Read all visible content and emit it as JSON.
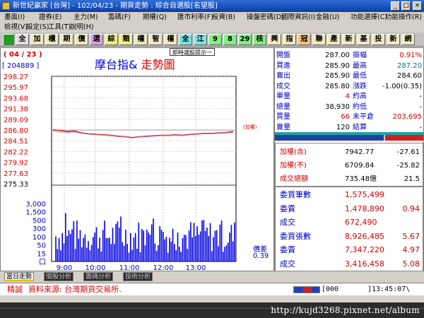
{
  "window": {
    "title": "新世紀贏家 [台灣] - 102/04/23 - 期貨走勢 : 綜合自選股[名望股]"
  },
  "menu": {
    "row1": [
      "畫面(I)",
      "證券(E)",
      "主力(M)",
      "籌碼(F)",
      "期權(Q)",
      "匯市利率(F)",
      "投資(B)",
      "操盤密碼(D)",
      "國際資訊(I)",
      "金融(U)",
      "功能選擇(C)",
      "功能操作(R)"
    ],
    "row2": [
      "檢視(V)",
      "設定(S)",
      "工具(T)",
      "說明(H)"
    ]
  },
  "toolbar": {
    "buttons": [
      "全",
      "加",
      "櫃",
      "期",
      "價",
      "選",
      "綜",
      "類",
      "權",
      "智",
      "權",
      "全",
      "江",
      "9",
      "8",
      "29",
      "核",
      "興",
      "指",
      "冠",
      "聯",
      "產",
      "新",
      "基",
      "投",
      "新",
      "網"
    ]
  },
  "chart": {
    "date": "( 04 / 23 )",
    "volume_readout": "[ 204889 ]",
    "title_black": "摩台指&",
    "title_red": "走勢圖",
    "popup_label": "即時選股提示一",
    "weighted_label": "(加權)",
    "spread_label": "價差",
    "spread_value": "0.39"
  },
  "chart_data": {
    "type": "line",
    "price_axis": [
      "298.27",
      "295.97",
      "293.68",
      "291.38",
      "289.09",
      "286.80",
      "284.51",
      "282.22",
      "279.92",
      "277.63",
      "275.33"
    ],
    "reference_price": "286.80",
    "volume_axis": [
      "3,000",
      "1,500",
      "500",
      "300",
      "100",
      "50",
      "15",
      "口"
    ],
    "time_labels": [
      "9:00",
      "10:00",
      "11:00",
      "12:00",
      "13:00"
    ],
    "ylim": [
      275.33,
      298.27
    ],
    "series": [
      {
        "values": [
          286.9,
          286.7,
          286.5,
          286.6,
          286.2,
          286.0,
          285.9,
          285.8,
          285.7,
          285.5,
          285.4,
          285.2,
          285.4,
          285.5,
          285.6,
          285.7,
          285.7,
          285.8,
          285.7,
          285.9,
          286.0,
          286.1,
          286.1,
          286.2,
          286.3,
          286.5
        ]
      },
      {
        "values": [
          286.6,
          286.4,
          286.3,
          286.4,
          286.1,
          285.9,
          285.8,
          285.7,
          285.6,
          285.4,
          285.3,
          285.1,
          285.3,
          285.4,
          285.5,
          285.6,
          285.6,
          285.7,
          285.6,
          285.8,
          285.9,
          286.0,
          286.0,
          286.1,
          286.2,
          286.3
        ]
      }
    ]
  },
  "quote": {
    "left": [
      {
        "label": "開盤",
        "value": "287.00"
      },
      {
        "label": "買進",
        "value": "285.90"
      },
      {
        "label": "賣出",
        "value": "285.90"
      },
      {
        "label": "成交",
        "value": "285.80"
      },
      {
        "label": "單量",
        "value": "4"
      },
      {
        "label": "總量",
        "value": "38,930"
      },
      {
        "label": "買量",
        "value": "66"
      },
      {
        "label": "賣量",
        "value": "120"
      }
    ],
    "right": [
      {
        "label": "振幅",
        "value": "0.91%"
      },
      {
        "label": "最高",
        "value": "287.20"
      },
      {
        "label": "最低",
        "value": "284.60"
      },
      {
        "label": "漲跌",
        "value": "-1.00(0.35)"
      },
      {
        "label": "約高",
        "value": "-"
      },
      {
        "label": "約低",
        "value": "-"
      },
      {
        "label": "未平倉",
        "value": "203,695"
      },
      {
        "label": "結算",
        "value": "-"
      }
    ]
  },
  "index": [
    {
      "label": "加權(含)",
      "value": "7942.77",
      "change": "-27.61"
    },
    {
      "label": "加權(不)",
      "value": "6709.84",
      "change": "-25.82"
    },
    {
      "label": "成交總額",
      "value": "735.48億",
      "change": "21.5"
    }
  ],
  "orders": [
    {
      "label": "委買筆數",
      "value": "1,575,499",
      "change": ""
    },
    {
      "label": "委賣",
      "value": "1,478,890",
      "change": "0.94"
    },
    {
      "label": "成交",
      "value": "672,490",
      "change": ""
    },
    {
      "label": "委買張數",
      "value": "8,926,485",
      "change": "5.67"
    },
    {
      "label": "委賣",
      "value": "7,347,220",
      "change": "4.97"
    },
    {
      "label": "成交",
      "value": "3,416,458",
      "change": "5.08"
    }
  ],
  "tabs": [
    "當日走勢",
    "個股分析",
    "籌碼分析",
    "技術分析"
  ],
  "status": {
    "tag": "精誠",
    "source": "資料來源: 台灣期貨交易所.",
    "counter": "[000",
    "clock": "]13:45:07\\"
  },
  "watermark": "http://kujd3268.pixnet.net/album",
  "colors": {
    "price_line": "#d00000",
    "avg_line": "#d070b0",
    "volume_bars": "#0000e0",
    "label_blue": "#0000c0",
    "up_red": "#d00000"
  }
}
